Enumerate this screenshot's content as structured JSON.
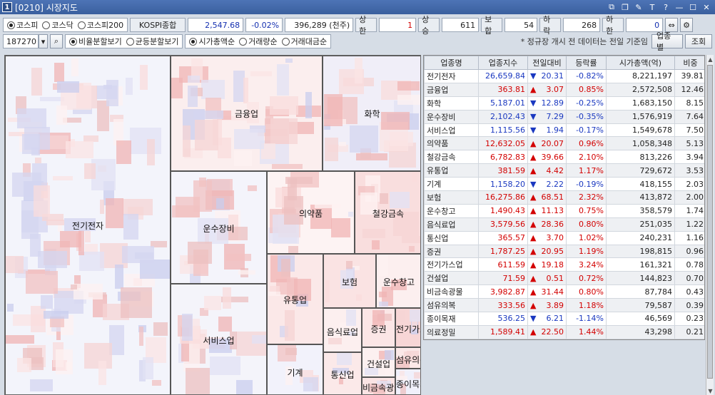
{
  "window": {
    "number": "1",
    "title": "[0210] 시장지도"
  },
  "market_tabs": [
    {
      "label": "코스피",
      "selected": true
    },
    {
      "label": "코스닥",
      "selected": false
    },
    {
      "label": "코스피200",
      "selected": false
    }
  ],
  "index": {
    "name": "KOSPI종합",
    "value": "2,547.68",
    "change": "-0.02%",
    "volume": "396,289 (천주)"
  },
  "counts": [
    {
      "label": "상한",
      "value": "1"
    },
    {
      "label": "상승",
      "value": "611"
    },
    {
      "label": "보합",
      "value": "54"
    },
    {
      "label": "하락",
      "value": "268"
    },
    {
      "label": "하한",
      "value": "0"
    }
  ],
  "code": "187270",
  "view_modes": [
    {
      "label": "비율분할보기",
      "selected": true
    },
    {
      "label": "균등분할보기",
      "selected": false
    }
  ],
  "sort_modes": [
    {
      "label": "시가총액순",
      "selected": true
    },
    {
      "label": "거래량순",
      "selected": false
    },
    {
      "label": "거래대금순",
      "selected": false
    }
  ],
  "note": "* 정규장 개시 전 데이터는 전일 기준임",
  "buttons": {
    "by_sector": "업종별",
    "query": "조회"
  },
  "table": {
    "headers": [
      "업종명",
      "업종지수",
      "전일대비",
      "등락률",
      "시가총액(억)",
      "비중"
    ],
    "rows": [
      {
        "name": "전기전자",
        "index": "26,659.84",
        "dir": "down",
        "chg": "20.31",
        "rate": "-0.82%",
        "cap": "8,221,197",
        "w": "39.81"
      },
      {
        "name": "금융업",
        "index": "363.81",
        "dir": "up",
        "chg": "3.07",
        "rate": "0.85%",
        "cap": "2,572,508",
        "w": "12.46"
      },
      {
        "name": "화학",
        "index": "5,187.01",
        "dir": "down",
        "chg": "12.89",
        "rate": "-0.25%",
        "cap": "1,683,150",
        "w": "8.15"
      },
      {
        "name": "운수장비",
        "index": "2,102.43",
        "dir": "down",
        "chg": "7.29",
        "rate": "-0.35%",
        "cap": "1,576,919",
        "w": "7.64"
      },
      {
        "name": "서비스업",
        "index": "1,115.56",
        "dir": "down",
        "chg": "1.94",
        "rate": "-0.17%",
        "cap": "1,549,678",
        "w": "7.50"
      },
      {
        "name": "의약품",
        "index": "12,632.05",
        "dir": "up",
        "chg": "20.07",
        "rate": "0.96%",
        "cap": "1,058,348",
        "w": "5.13"
      },
      {
        "name": "철강금속",
        "index": "6,782.83",
        "dir": "up",
        "chg": "39.66",
        "rate": "2.10%",
        "cap": "813,226",
        "w": "3.94"
      },
      {
        "name": "유통업",
        "index": "381.59",
        "dir": "up",
        "chg": "4.42",
        "rate": "1.17%",
        "cap": "729,672",
        "w": "3.53"
      },
      {
        "name": "기계",
        "index": "1,158.20",
        "dir": "down",
        "chg": "2.22",
        "rate": "-0.19%",
        "cap": "418,155",
        "w": "2.03"
      },
      {
        "name": "보험",
        "index": "16,275.86",
        "dir": "up",
        "chg": "68.51",
        "rate": "2.32%",
        "cap": "413,872",
        "w": "2.00"
      },
      {
        "name": "운수창고",
        "index": "1,490.43",
        "dir": "up",
        "chg": "11.13",
        "rate": "0.75%",
        "cap": "358,579",
        "w": "1.74"
      },
      {
        "name": "음식료업",
        "index": "3,579.56",
        "dir": "up",
        "chg": "28.36",
        "rate": "0.80%",
        "cap": "251,035",
        "w": "1.22"
      },
      {
        "name": "통신업",
        "index": "365.57",
        "dir": "up",
        "chg": "3.70",
        "rate": "1.02%",
        "cap": "240,231",
        "w": "1.16"
      },
      {
        "name": "증권",
        "index": "1,787.25",
        "dir": "up",
        "chg": "20.95",
        "rate": "1.19%",
        "cap": "198,815",
        "w": "0.96"
      },
      {
        "name": "전기가스업",
        "index": "611.59",
        "dir": "up",
        "chg": "19.18",
        "rate": "3.24%",
        "cap": "161,321",
        "w": "0.78"
      },
      {
        "name": "건설업",
        "index": "71.59",
        "dir": "up",
        "chg": "0.51",
        "rate": "0.72%",
        "cap": "144,823",
        "w": "0.70"
      },
      {
        "name": "비금속광물",
        "index": "3,982.87",
        "dir": "up",
        "chg": "31.44",
        "rate": "0.80%",
        "cap": "87,784",
        "w": "0.43"
      },
      {
        "name": "섬유의복",
        "index": "333.56",
        "dir": "up",
        "chg": "3.89",
        "rate": "1.18%",
        "cap": "79,587",
        "w": "0.39"
      },
      {
        "name": "종이목재",
        "index": "536.25",
        "dir": "down",
        "chg": "6.21",
        "rate": "-1.14%",
        "cap": "46,569",
        "w": "0.23"
      },
      {
        "name": "의료정밀",
        "index": "1,589.41",
        "dir": "up",
        "chg": "22.50",
        "rate": "1.44%",
        "cap": "43,298",
        "w": "0.21"
      }
    ]
  },
  "treemap": {
    "sectors": [
      "전기전자",
      "금융업",
      "화학",
      "운수장비",
      "의약품",
      "철강금속",
      "유통업",
      "서비스업",
      "보험",
      "운수창고",
      "기계",
      "음식료업",
      "증권",
      "전기가스업",
      "통신업",
      "건설업",
      "섬유의복",
      "비금속광물",
      "종이목재"
    ]
  },
  "colors": {
    "up": "#d30000",
    "down": "#1a38c0",
    "titlebar": "#3a5f9e"
  }
}
